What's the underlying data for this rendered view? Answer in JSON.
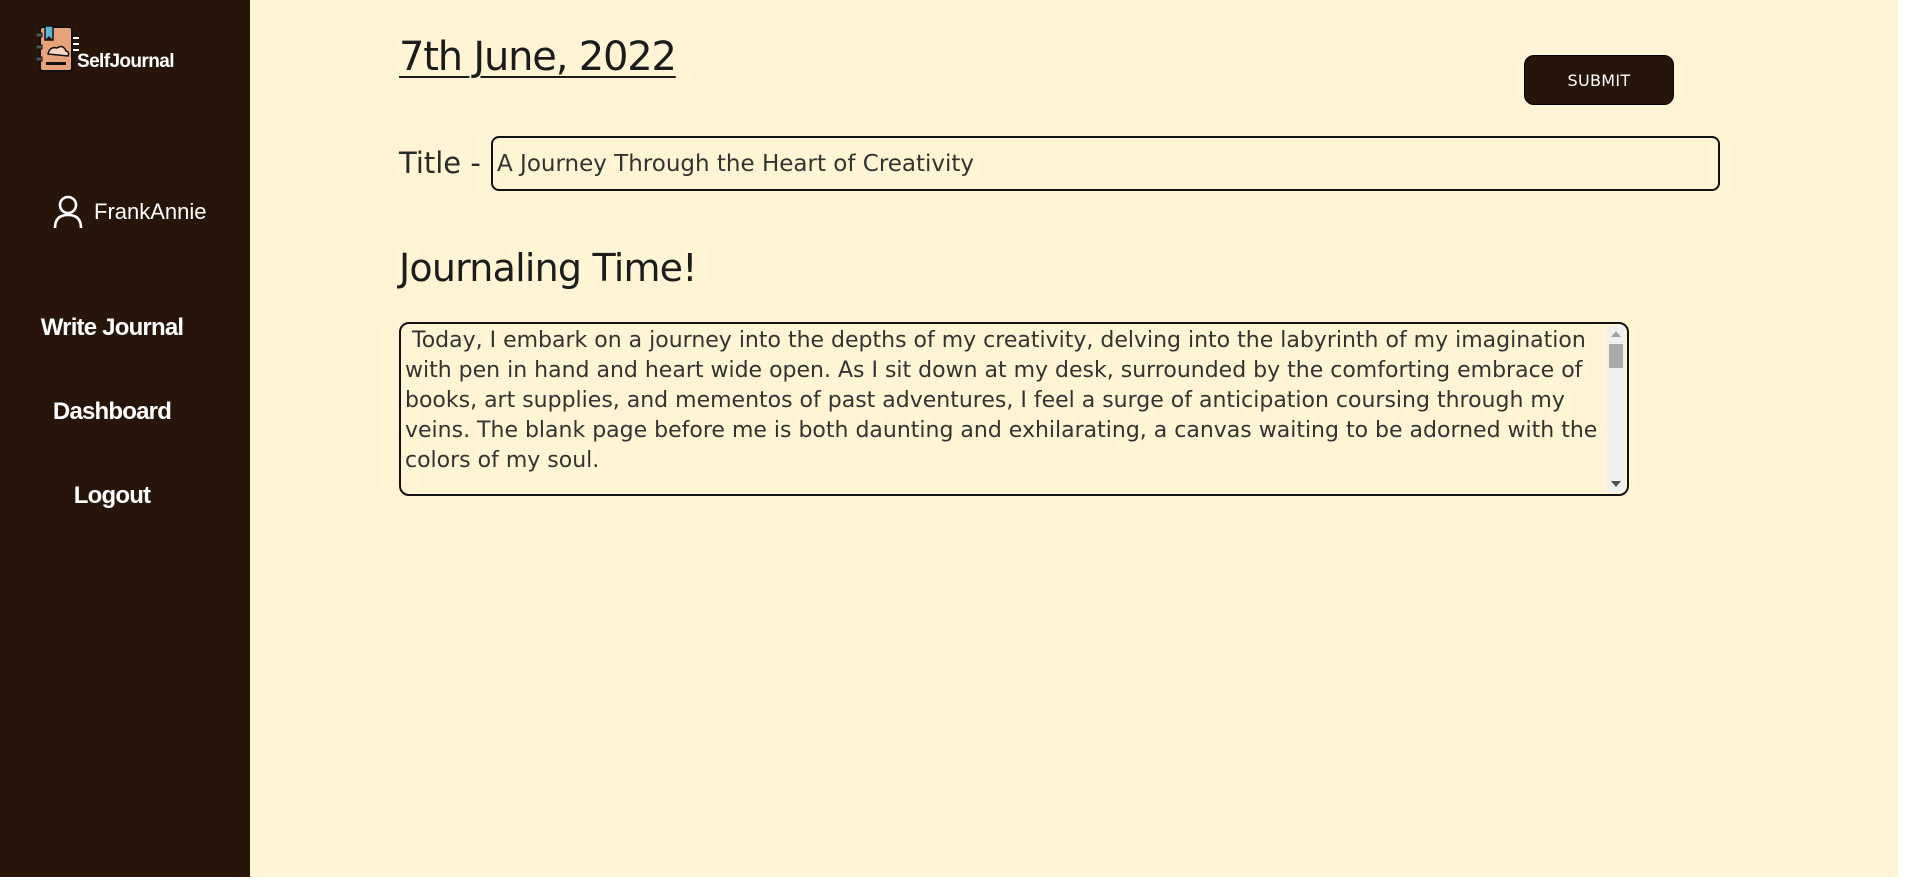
{
  "brand": {
    "name": "SelfJournal",
    "icon": "journal-logo-icon"
  },
  "user": {
    "name": "FrankAnnie",
    "icon": "user-icon"
  },
  "nav": {
    "write": "Write Journal",
    "dashboard": "Dashboard",
    "logout": "Logout"
  },
  "entry": {
    "date": "7th June, 2022",
    "submit_label": "SUBMIT",
    "title_label": "Title -",
    "title_value": "A Journey Through the Heart of Creativity",
    "section_heading": "Journaling Time!",
    "body": " Today, I embark on a journey into the depths of my creativity, delving into the labyrinth of my imagination with pen in hand and heart wide open. As I sit down at my desk, surrounded by the comforting embrace of books, art supplies, and mementos of past adventures, I feel a surge of anticipation coursing through my veins. The blank page before me is both daunting and exhilarating, a canvas waiting to be adorned with the colors of my soul."
  },
  "colors": {
    "sidebar_bg": "#28150a",
    "page_bg": "#fff4d3",
    "button_bg": "#28150a",
    "text": "#1c1c1c"
  }
}
